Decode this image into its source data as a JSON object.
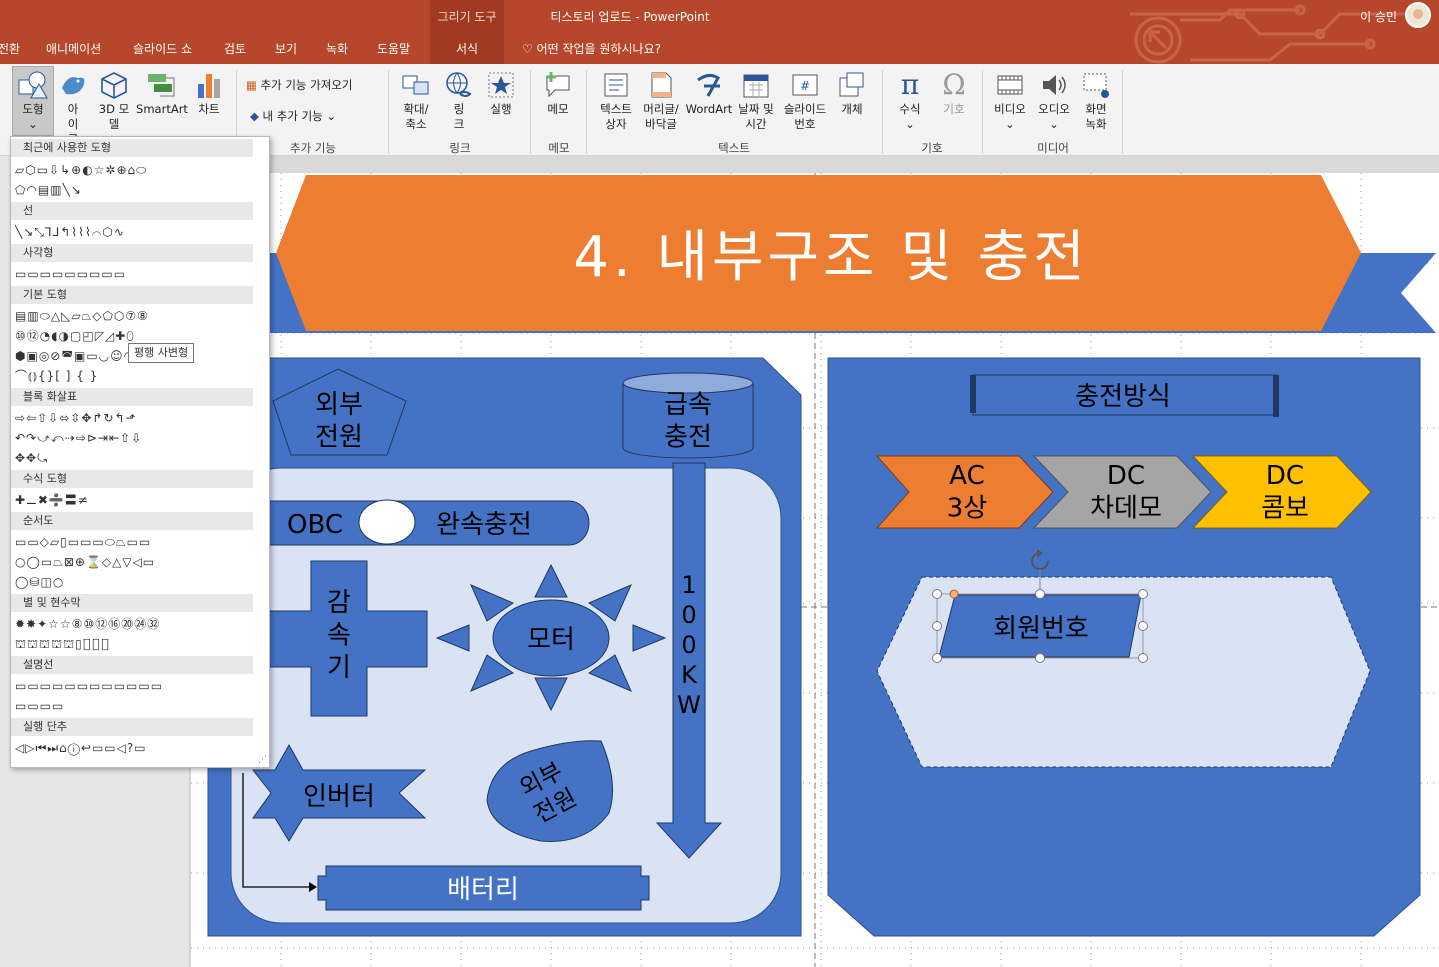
{
  "window": {
    "context_group": "그리기 도구",
    "title": "티스토리 업로드  -  PowerPoint",
    "user": "이 승민"
  },
  "tabs": [
    "전환",
    "애니메이션",
    "슬라이드 쇼",
    "검토",
    "보기",
    "녹화",
    "도움말",
    "서식"
  ],
  "tell_me": "어떤 작업을 원하시나요?",
  "ribbon": {
    "shapes": "도형",
    "icons": "아이콘",
    "model3d": "3D 모델",
    "smartart": "SmartArt",
    "chart": "차트",
    "get_addins": "추가 기능 가져오기",
    "my_addins": "내 추가 기능",
    "addins_group": "추가 기능",
    "zoom": "확대/축소",
    "link": "링크",
    "action": "실행",
    "links_group": "링크",
    "comment": "메모",
    "comment_group": "메모",
    "textbox": "텍스트 상자",
    "header_footer": "머리글/바닥글",
    "wordart": "WordArt",
    "datetime": "날짜 및 시간",
    "slide_number": "슬라이드 번호",
    "object": "개체",
    "text_group": "텍스트",
    "equation": "수식",
    "symbol": "기호",
    "symbols_group": "기호",
    "video": "비디오",
    "audio": "오디오",
    "screen_rec": "화면 녹화",
    "media_group": "미디어"
  },
  "shapes_panel": {
    "sections": [
      "최근에 사용한 도형",
      "선",
      "사각형",
      "기본 도형",
      "블록 화살표",
      "수식 도형",
      "순서도",
      "별 및 현수막",
      "설명선",
      "실행 단추"
    ],
    "rows": [
      "▱⬡▭⇩↳⊕◐☆✲⊕⌂⬭",
      "⬠◠▤▥╲↘",
      "╲↘⤡⅂⅃↰⌇⌇⌇⌒⬡∿",
      "▭▭▭▭▭▭▭▭▭",
      "▤▥⬭△◺▱⏢◇⬠⬡⑦⑧",
      "⑩⑫◔◖◑▢◰◸◿✚⬯",
      "⬢▣◎⊘◚▣▭◡☺◠❤✹◑☾☁",
      "⌒⦅⦆{}[ ] { }",
      "⇨⇦⇧⇩⬄⇳✥↱↻↰⬏",
      "↶↷⤻⤺⇢⇨⊳⇥⇤⇧⇩",
      "✥✥⤿",
      "✚⚊✖➗〓≠",
      "▭▭◇▱▯▭▭▭⬭⏢▭▭",
      "○◯▭⏢⊠⊕⌛◇△▽◁▭",
      "◯⛁◫○",
      "✹✸✦☆☆⑧⑩⑫⑯⑳㉔㉜",
      "⛫⛫⛫⛫⛫▯⎕⎕⎕",
      "▭▭▭▭▭▭▭▭▭▭▭▭",
      "▭▭▭▭",
      "◁▷⏮⏭⌂ⓘ↩▭▭◁?▭"
    ],
    "tooltip": "평행 사변형"
  },
  "slide": {
    "title": "4. 내부구조 및 충전",
    "external_power": "외부\n전원",
    "fast_charge": "급속\n충전",
    "obc": "OBC",
    "slow_charge": "완속충전",
    "reducer": "감\n속\n기",
    "motor": "모터",
    "kw": "1\n0\n0\nK\nW",
    "inverter": "인버터",
    "external_power2": "외부\n전원",
    "battery": "배터리",
    "charge_method": "충전방식",
    "chev_ac": "AC\n3상",
    "chev_dc1": "DC\n차데모",
    "chev_dc2": "DC\n콤보",
    "member": "회원번호"
  },
  "colors": {
    "titlebar": "#b7472a",
    "slide_blue": "#4472c4",
    "light_blue": "#dae3f3",
    "orange": "#ed7d31",
    "grey": "#a5a5a5",
    "gold": "#ffc000"
  }
}
